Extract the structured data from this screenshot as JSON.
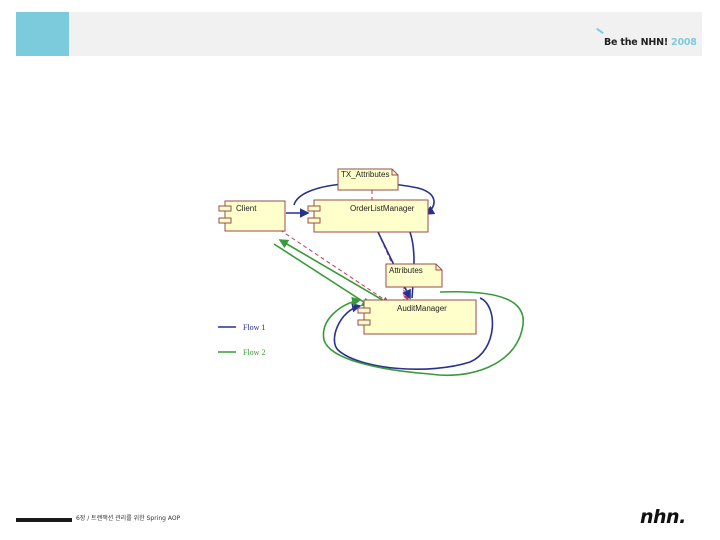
{
  "header": {
    "brand_text": "Be the NHN!",
    "brand_year": "2008"
  },
  "diagram": {
    "notes": {
      "tx_attributes": "TX_Attributes",
      "attributes": "Attributes"
    },
    "components": {
      "client": "Client",
      "order_list_manager": "OrderListManager",
      "audit_manager": "AuditManager"
    },
    "legend": [
      {
        "label": "Flow 1",
        "color": "#27318f"
      },
      {
        "label": "Flow 2",
        "color": "#3a9a3a"
      }
    ],
    "colors": {
      "box_fill": "#ffffcc",
      "box_stroke": "#9a4d4d",
      "flow1": "#27318f",
      "flow2": "#3a9a3a",
      "dashed_link": "#c03a5a"
    }
  },
  "footer": {
    "caption": "6장 / 트랜잭션 관리를 위한 Spring AOP",
    "logo": "nhn."
  }
}
